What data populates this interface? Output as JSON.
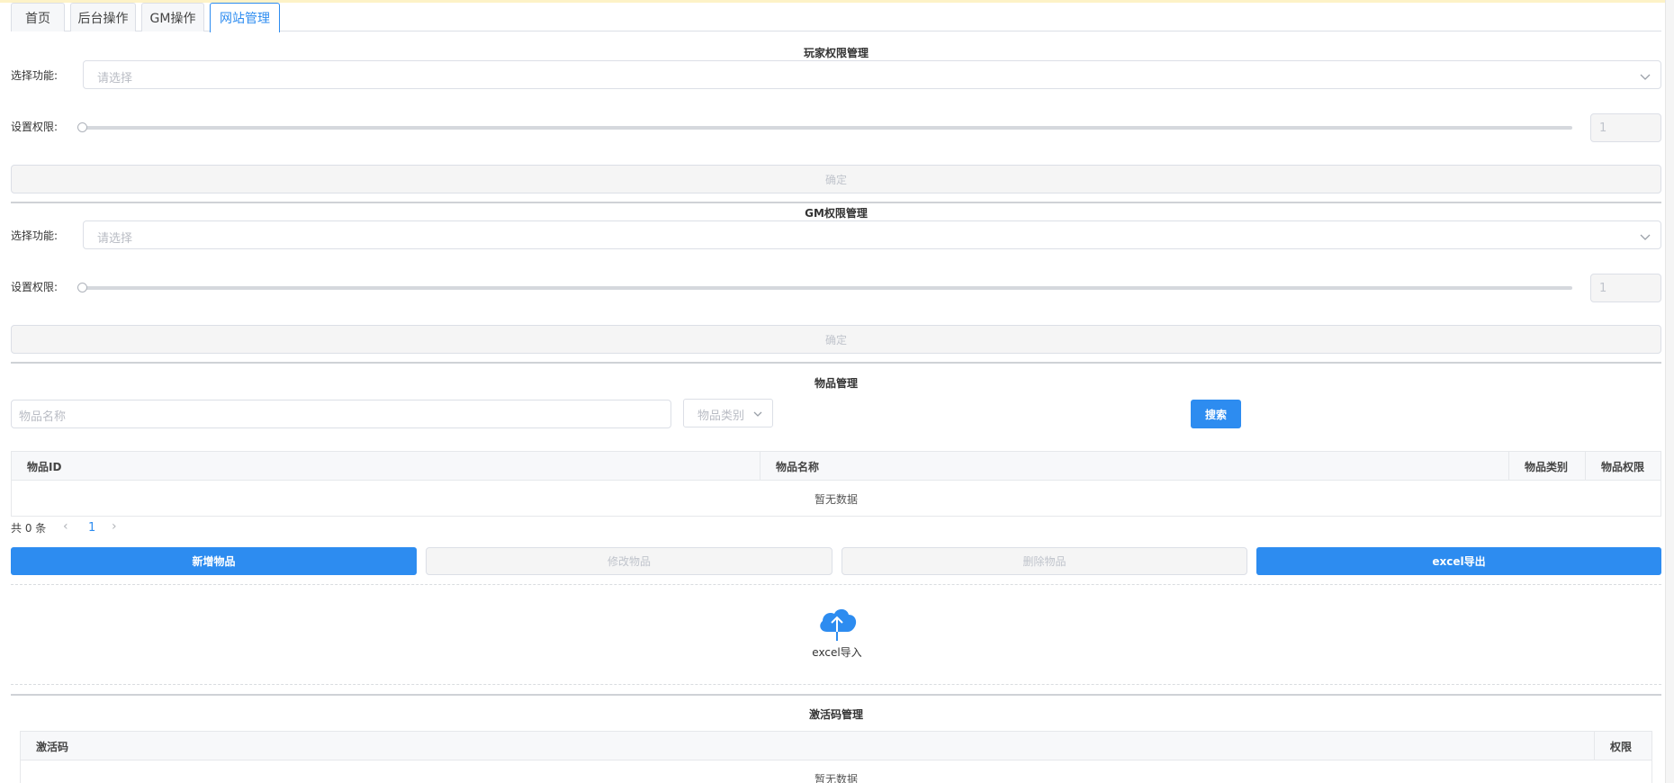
{
  "tabs": [
    {
      "label": "首页",
      "active": false
    },
    {
      "label": "后台操作",
      "active": false
    },
    {
      "label": "GM操作",
      "active": false
    },
    {
      "label": "网站管理",
      "active": true
    }
  ],
  "player_perm": {
    "title": "玩家权限管理",
    "select_label": "选择功能:",
    "select_placeholder": "请选择",
    "level_label": "设置权限:",
    "level_value": "1",
    "confirm_label": "确定"
  },
  "gm_perm": {
    "title": "GM权限管理",
    "select_label": "选择功能:",
    "select_placeholder": "请选择",
    "level_label": "设置权限:",
    "level_value": "1",
    "confirm_label": "确定"
  },
  "items": {
    "title": "物品管理",
    "name_placeholder": "物品名称",
    "category_placeholder": "物品类别",
    "search_label": "搜索",
    "columns": [
      "物品ID",
      "物品名称",
      "物品类别",
      "物品权限"
    ],
    "empty_text": "暂无数据",
    "total_text": "共 0 条",
    "current_page": "1",
    "add_label": "新增物品",
    "edit_label": "修改物品",
    "delete_label": "删除物品",
    "export_label": "excel导出",
    "import_label": "excel导入"
  },
  "codes": {
    "title": "激活码管理",
    "columns": [
      "激活码",
      "权限"
    ],
    "empty_text": "暂无数据"
  },
  "colors": {
    "primary": "#2d8cf0",
    "border": "#dcdfe6",
    "disabled_bg": "#f5f5f5"
  }
}
